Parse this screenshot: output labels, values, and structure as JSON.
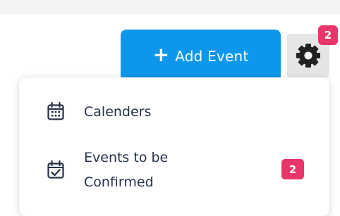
{
  "header": {
    "add_event_label": "Add Event",
    "settings_badge": "2"
  },
  "menu": {
    "items": [
      {
        "label": "Calenders",
        "icon": "calendar-icon"
      },
      {
        "label_line1": "Events to be",
        "label_line2": "Confirmed",
        "icon": "calendar-check-icon",
        "badge": "2"
      }
    ]
  },
  "colors": {
    "primary_button": "#0d97ec",
    "badge": "#e8366a",
    "menu_text": "#26324a"
  }
}
